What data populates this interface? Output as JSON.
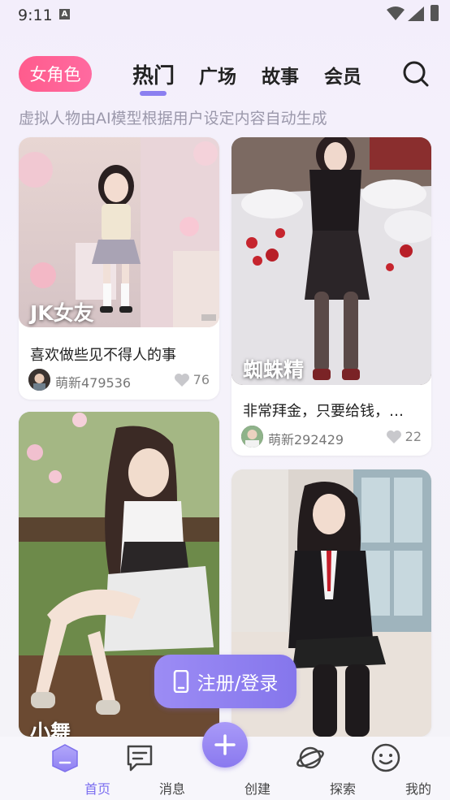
{
  "status_bar": {
    "time": "9:11"
  },
  "header": {
    "role_label": "女角色",
    "tabs": [
      "热门",
      "广场",
      "故事",
      "会员"
    ],
    "active_tab": "热门"
  },
  "subtitle": "虚拟人物由AI模型根据用户设定内容自动生成",
  "cards": [
    {
      "name": "JK女友",
      "desc": "喜欢做些见不得人的事",
      "author": "萌新479536",
      "likes": "76"
    },
    {
      "name": "蜘蛛精",
      "desc": "非常拜金，只要给钱，啥...",
      "author": "萌新292429",
      "likes": "22"
    },
    {
      "name": "小舞"
    },
    {
      "name": ""
    }
  ],
  "register_label": "注册/登录",
  "nav": {
    "home": "首页",
    "messages": "消息",
    "create": "创建",
    "explore": "探索",
    "mine": "我的"
  },
  "colors": {
    "accent": "#8b7ff0",
    "pink": "#ff5c8d"
  }
}
